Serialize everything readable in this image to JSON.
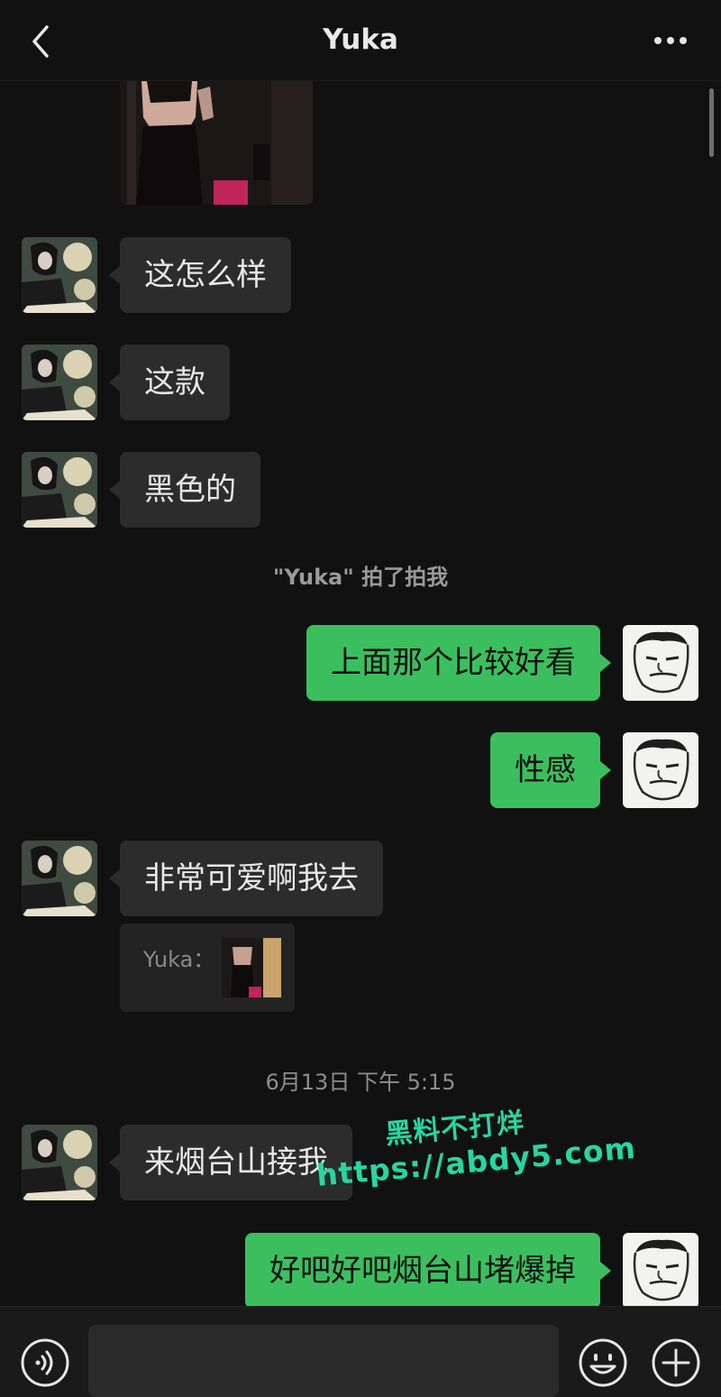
{
  "header": {
    "title": "Yuka",
    "back_icon": "chevron-left-icon",
    "more_icon": "more-dots-icon"
  },
  "messages": [
    {
      "side": "in",
      "text": "这怎么样"
    },
    {
      "side": "in",
      "text": "这款"
    },
    {
      "side": "in",
      "text": "黑色的"
    },
    {
      "side": "out",
      "text": "上面那个比较好看"
    },
    {
      "side": "out",
      "text": "性感"
    },
    {
      "side": "in",
      "text": "非常可爱啊我去"
    },
    {
      "side": "in",
      "text": "来烟台山接我"
    },
    {
      "side": "out",
      "text": "好吧好吧烟台山堵爆掉"
    }
  ],
  "system": {
    "pat": "\"Yuka\" 拍了拍我",
    "timestamp": "6月13日 下午 5:15"
  },
  "quote": {
    "label": "Yuka："
  },
  "watermark": {
    "line1": "黑料不打烊",
    "line2": "https://abdy5.com"
  },
  "input_bar": {
    "voice_icon": "voice-icon",
    "emoji_icon": "emoji-icon",
    "plus_icon": "plus-icon"
  },
  "colors": {
    "background": "#111111",
    "incoming_bubble": "#2c2c2c",
    "outgoing_bubble": "#3bbf5e",
    "watermark": "#27d6a0"
  }
}
